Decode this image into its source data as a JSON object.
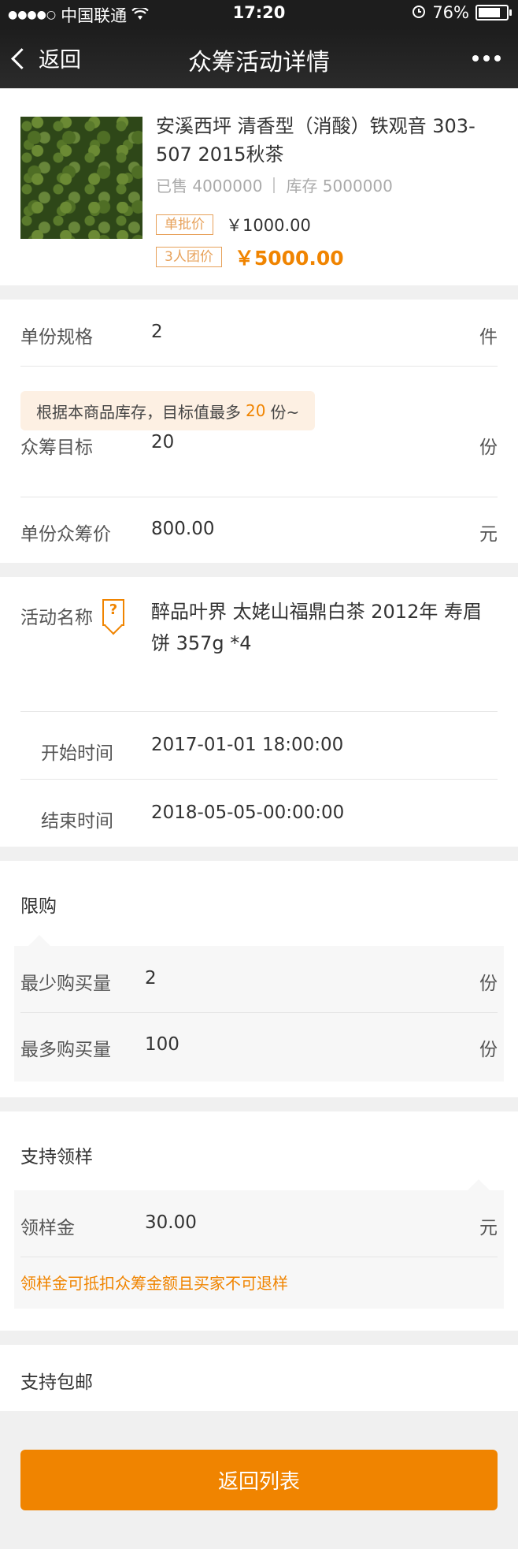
{
  "status": {
    "carrier": "中国联通",
    "time": "17:20",
    "battery": "76%"
  },
  "nav": {
    "back": "返回",
    "title": "众筹活动详情"
  },
  "product": {
    "name": "安溪西坪 清香型（消酸）铁观音 303-507  2015秋茶",
    "sold_label": "已售 4000000",
    "stock_label": "库存 5000000",
    "single_tag": "单批价",
    "single_price": "￥1000.00",
    "group_tag": "3人团价",
    "group_price": "￥5000.00"
  },
  "spec": {
    "unit_spec": {
      "label": "单份规格",
      "value": "2",
      "unit": "件"
    },
    "tip": {
      "prefix": "根据本商品库存，目标值最多",
      "value": "20",
      "suffix": "份~"
    },
    "target": {
      "label": "众筹目标",
      "value": "20",
      "unit": "份"
    },
    "price": {
      "label": "单份众筹价",
      "value": "800.00",
      "unit": "元"
    }
  },
  "activity": {
    "name_label": "活动名称",
    "name_value": "醉品叶界 太姥山福鼎白茶 2012年 寿眉饼 357g *4",
    "start": {
      "label": "开始时间",
      "value": "2017-01-01 18:00:00"
    },
    "end": {
      "label": "结束时间",
      "value": "2018-05-05-00:00:00"
    }
  },
  "limit": {
    "title": "限购",
    "min": {
      "label": "最少购买量",
      "value": "2",
      "unit": "份"
    },
    "max": {
      "label": "最多购买量",
      "value": "100",
      "unit": "份"
    }
  },
  "sample": {
    "title": "支持领样",
    "fee": {
      "label": "领样金",
      "value": "30.00",
      "unit": "元"
    },
    "note": "领样金可抵扣众筹金额且买家不可退样"
  },
  "shipping": {
    "title": "支持包邮"
  },
  "button": {
    "label": "返回列表"
  },
  "colors": {
    "accent": "#f08400",
    "nav_bg": "#1d1d1d",
    "tip_bg": "#fdf0e3"
  }
}
